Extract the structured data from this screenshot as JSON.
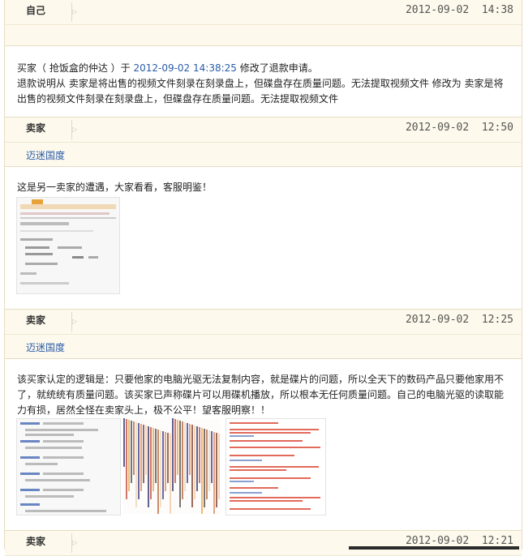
{
  "posts": [
    {
      "name": "自己",
      "time": "2012-09-02  14:38"
    },
    {
      "name": "卖家",
      "time": "2012-09-02  12:50",
      "tag": "迈迷国度"
    },
    {
      "name": "卖家",
      "time": "2012-09-02  12:25",
      "tag": "迈迷国度"
    },
    {
      "name": "卖家",
      "time": "2012-09-02  12:21"
    }
  ],
  "log": {
    "line1_prefix": "买家（ 抢饭盒的仲达 ）于 ",
    "line1_time": "2012-09-02 14:38:25",
    "line1_suffix": " 修改了退款申请。",
    "line2": "退款说明从 卖家是将出售的视频文件刻录在刻录盘上，但碟盘存在质量问题。无法提取视频文件 修改为 卖家是将出售的视频文件刻录在刻录盘上，但碟盘存在质量问题。无法提取视频文件"
  },
  "msg1": "这是另一卖家的遭遇，大家看看，客服明鉴！",
  "msg2": "该买家认定的逻辑是：只要他家的电脑光驱无法复制内容，就是碟片的问题，所以全天下的数码产品只要他家用不了，就统统有质量问题。该买家已声称碟片可以用碟机播放，所以根本无任何质量问题。自己的电脑光驱的读取能力有损，居然全怪在卖家头上，极不公平！望客服明察！！"
}
